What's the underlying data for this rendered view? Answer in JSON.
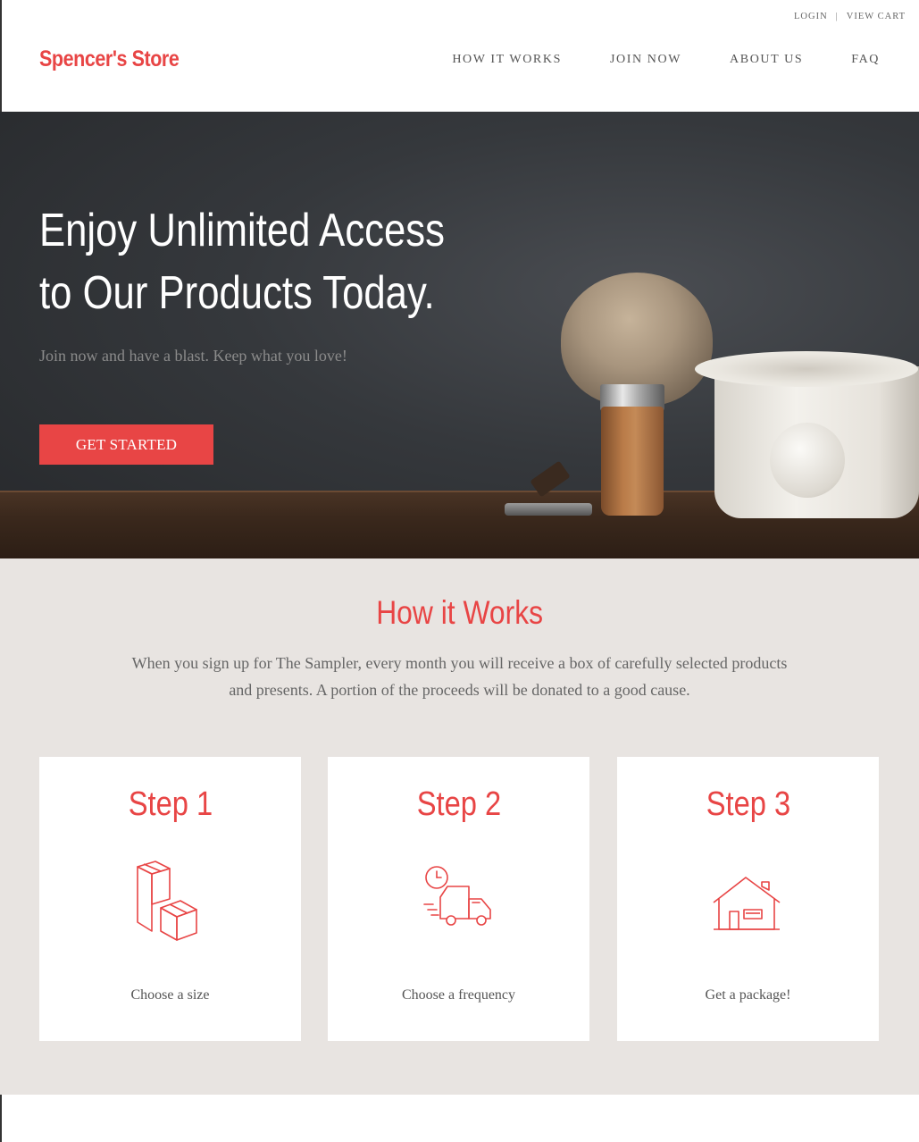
{
  "topbar": {
    "login": "LOGIN",
    "separator": "|",
    "view_cart": "VIEW CART"
  },
  "brand": {
    "logo": "Spencer's Store"
  },
  "nav": {
    "items": [
      "HOW IT WORKS",
      "JOIN NOW",
      "ABOUT US",
      "FAQ"
    ]
  },
  "hero": {
    "title_line1": "Enjoy Unlimited Access",
    "title_line2": "to Our Products Today.",
    "subtitle": "Join now and have a blast. Keep what you love!",
    "cta": "GET STARTED"
  },
  "how": {
    "heading": "How it Works",
    "description": "When you sign up for The Sampler, every month you will receive a box of carefully selected products and presents. A portion of the proceeds will be donated to a good cause.",
    "steps": [
      {
        "title": "Step 1",
        "caption": "Choose a size",
        "icon": "boxes-icon"
      },
      {
        "title": "Step 2",
        "caption": "Choose a frequency",
        "icon": "delivery-truck-icon"
      },
      {
        "title": "Step 3",
        "caption": "Get a package!",
        "icon": "house-icon"
      }
    ]
  },
  "colors": {
    "accent": "#e84545",
    "section_bg": "#e8e4e1"
  }
}
